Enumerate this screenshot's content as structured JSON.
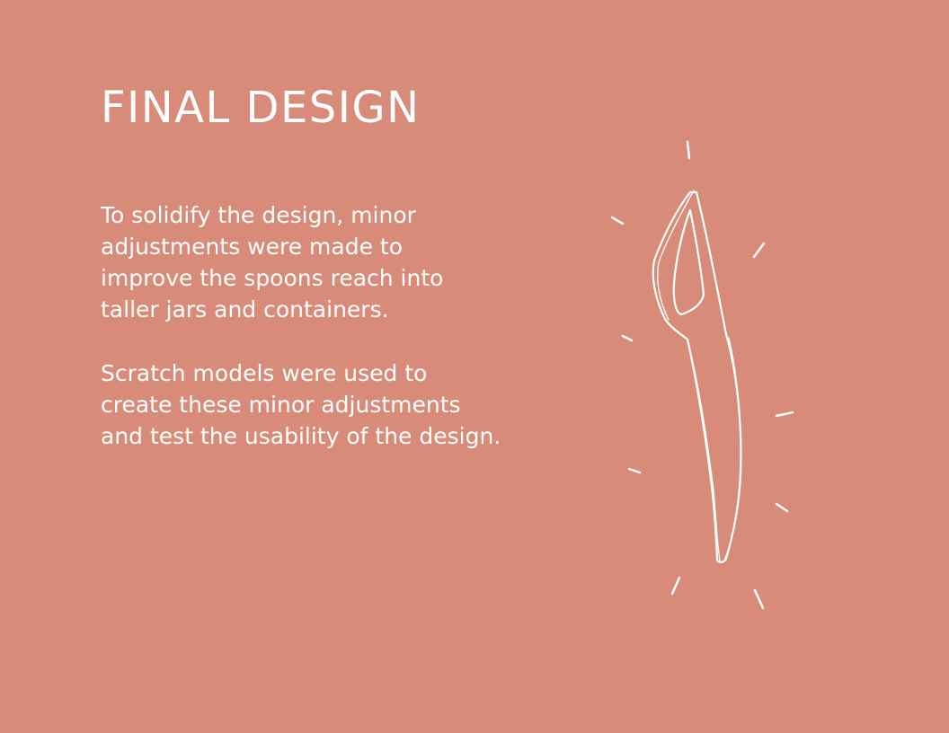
{
  "colors": {
    "background": "#d98b7a",
    "text": "#ffffff",
    "sketch_stroke": "#ffffff"
  },
  "title": "FINAL DESIGN",
  "paragraphs": [
    "To solidify the design, minor\nadjustments were made to\nimprove the spoons reach into\ntaller jars and containers.",
    "Scratch models were used to\ncreate these minor adjustments\nand test the usability of the design."
  ],
  "illustration": {
    "subject": "spoon-sketch-icon"
  }
}
